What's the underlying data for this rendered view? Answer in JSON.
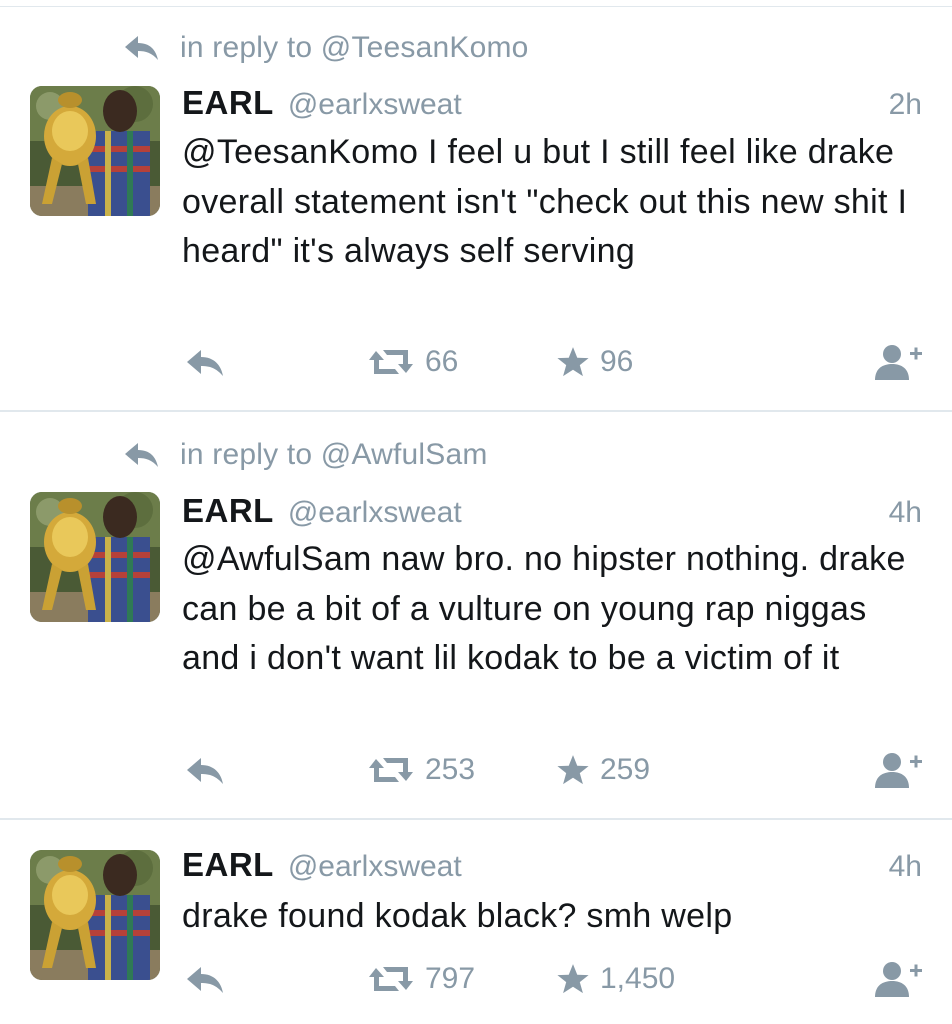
{
  "tweets": [
    {
      "reply_context": "in reply to @TeesanKomo",
      "display_name": "EARL",
      "handle": "@earlxsweat",
      "timestamp": "2h",
      "text": "@TeesanKomo I feel u but I still feel like drake overall statement isn't \"check out this new shit I heard\" it's always self serving",
      "retweets": "66",
      "likes": "96"
    },
    {
      "reply_context": "in reply to @AwfulSam",
      "display_name": "EARL",
      "handle": "@earlxsweat",
      "timestamp": "4h",
      "text": "@AwfulSam naw bro. no hipster nothing. drake can be a bit of a vulture on young rap niggas and i don't want lil kodak to be a victim of it",
      "retweets": "253",
      "likes": "259"
    },
    {
      "display_name": "EARL",
      "handle": "@earlxsweat",
      "timestamp": "4h",
      "text": "drake found kodak black? smh welp",
      "retweets": "797",
      "likes": "1,450"
    }
  ],
  "icons": {
    "reply": "reply-icon",
    "retweet": "retweet-icon",
    "like": "star-icon",
    "follow": "follow-icon"
  },
  "colors": {
    "muted": "#8899a6",
    "text": "#14171a",
    "divider": "#e1e8ed"
  }
}
